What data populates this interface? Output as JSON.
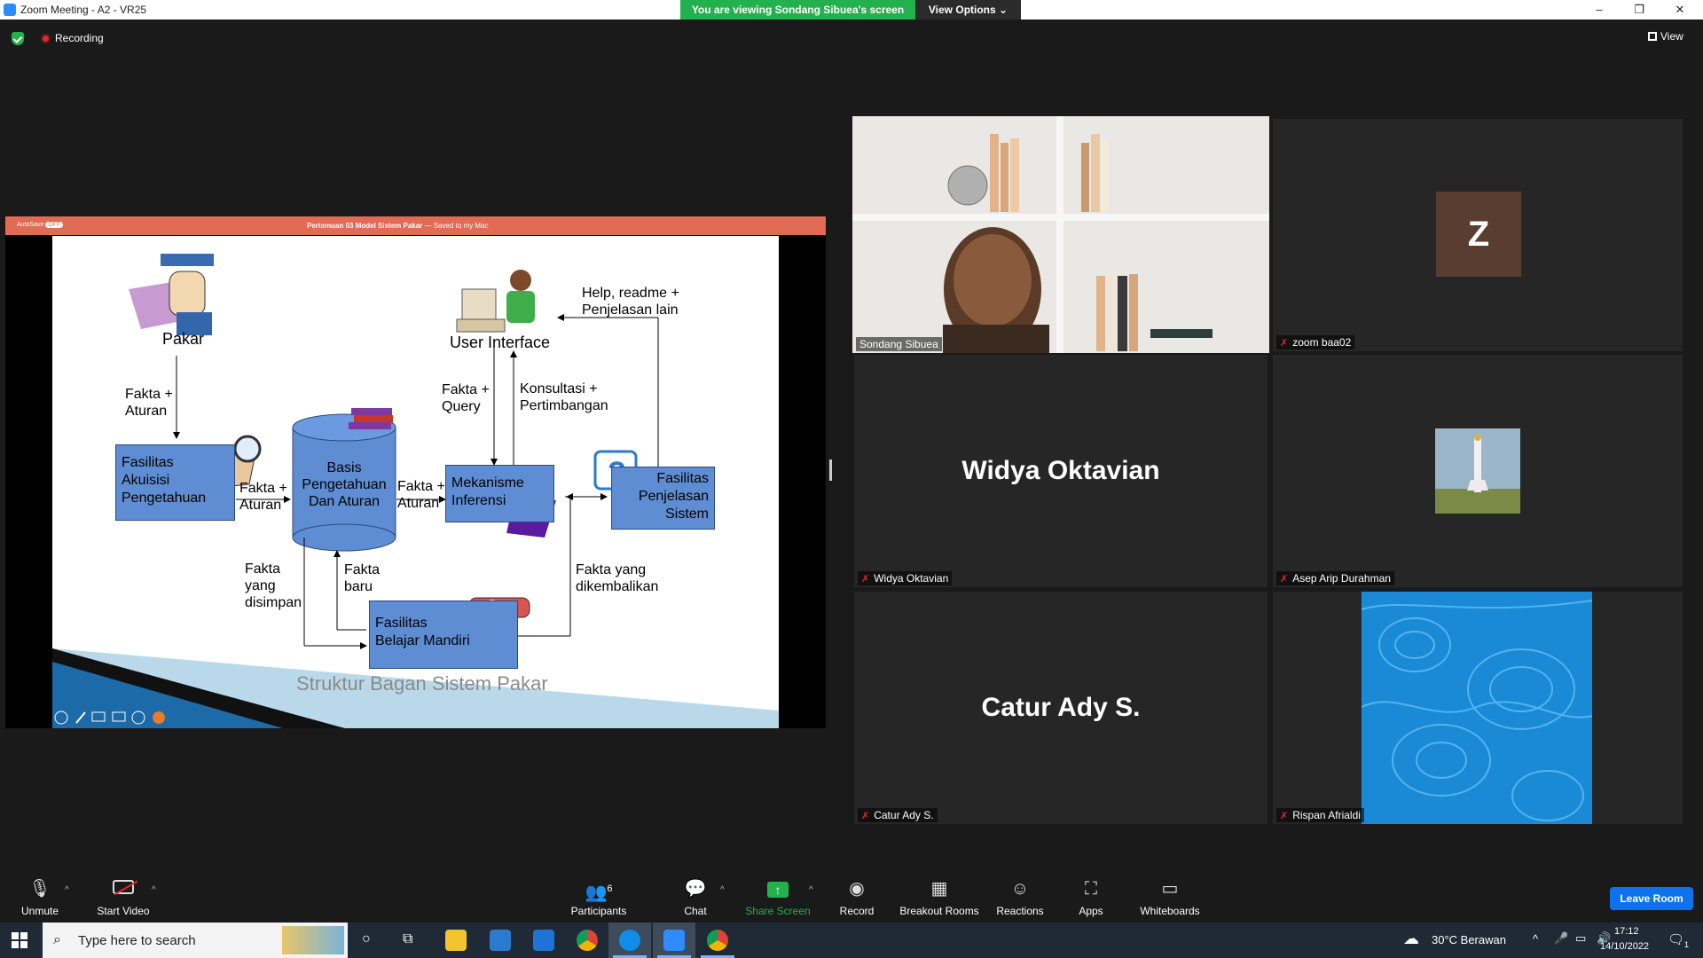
{
  "window": {
    "title": "Zoom Meeting - A2 - VR25",
    "viewing_banner": "You are viewing Sondang Sibuea's screen",
    "view_options": "View Options",
    "minimize": "–",
    "restore": "❐",
    "close": "✕"
  },
  "status": {
    "recording": "Recording",
    "view": "View"
  },
  "share": {
    "autosave": "AutoSave",
    "autosave_state": "OFF",
    "doc_title": "Pertemuan 03 Model Sistem Pakar",
    "doc_saved": "— Saved to my Mac",
    "slide": {
      "pakar": "Pakar",
      "user_interface": "User Interface",
      "help_readme": "Help, readme +\nPenjelasan lain",
      "fakta_aturan_1": "Fakta +\nAturan",
      "fakta_query": "Fakta +\nQuery",
      "konsultasi": "Konsultasi +\nPertimbangan",
      "akuisisi": "Fasilitas\nAkuisisi\nPengetahuan",
      "fakta_aturan_2": "Fakta +\nAturan",
      "basis": "Basis\nPengetahuan\nDan Aturan",
      "fakta_aturan_3": "Fakta +\nAturan",
      "mekanisme": "Mekanisme\nInferensi",
      "penjelasan": "Fasilitas\nPenjelasan\nSistem",
      "fakta_disimpan": "Fakta\nyang\ndisimpan",
      "fakta_baru": "Fakta\nbaru",
      "fakta_dikembalikan": "Fakta yang\ndikembalikan",
      "belajar": "Fasilitas\nBelajar Mandiri",
      "title": "Struktur Bagan Sistem Pakar"
    }
  },
  "participants_tiles": [
    {
      "name": "Sondang Sibuea",
      "muted": false
    },
    {
      "name": "zoom baa02",
      "muted": true,
      "avatar_letter": "Z"
    },
    {
      "name": "Widya Oktavian",
      "muted": true,
      "display": "Widya Oktavian"
    },
    {
      "name": "Asep Arip Durahman",
      "muted": true
    },
    {
      "name": "Catur Ady S.",
      "muted": true,
      "display": "Catur Ady S."
    },
    {
      "name": "Rispan Afrialdi",
      "muted": true
    }
  ],
  "toolbar": {
    "unmute": "Unmute",
    "start_video": "Start Video",
    "participants": "Participants",
    "participants_count": "6",
    "chat": "Chat",
    "share_screen": "Share Screen",
    "record": "Record",
    "breakout_rooms": "Breakout Rooms",
    "reactions": "Reactions",
    "apps": "Apps",
    "whiteboards": "Whiteboards",
    "leave_room": "Leave Room"
  },
  "taskbar": {
    "search_placeholder": "Type here to search",
    "weather": "30°C  Berawan",
    "time": "17:12",
    "date": "14/10/2022",
    "notifications": "1"
  },
  "colors": {
    "active_speaker": "#d6e83e",
    "banner_green": "#23b14d",
    "leave_blue": "#0e72ed",
    "slide_box": "#5f8dd3",
    "ppt_bar": "#e26b55"
  }
}
